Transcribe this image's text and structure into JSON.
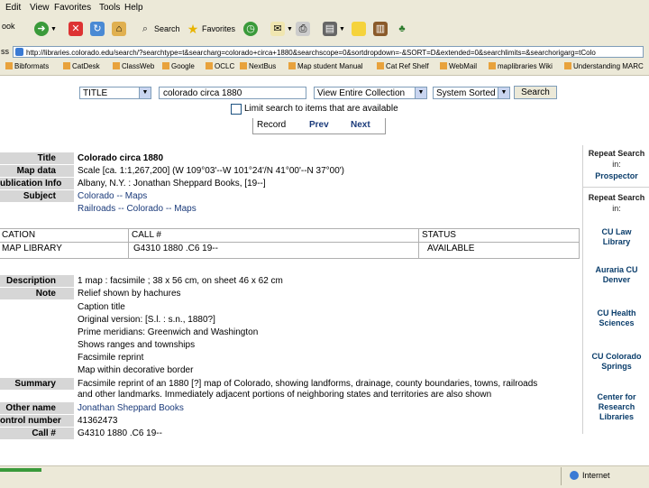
{
  "menu": [
    "Edit",
    "View",
    "Favorites",
    "Tools",
    "Help"
  ],
  "toolbar": {
    "back_label": "ook",
    "search_label": "Search",
    "favorites_label": "Favorites"
  },
  "address": {
    "label": "ss",
    "url": "http://libraries.colorado.edu/search/?searchtype=t&searcharg=colorado+circa+1880&searchscope=0&sortdropdown=-&SORT=D&extended=0&searchlimits=&searchorigarg=tColo"
  },
  "links": [
    "Bibformats",
    "CatDesk",
    "ClassWeb",
    "Google",
    "OCLC",
    "NextBus",
    "Map student Manual",
    "Cat Ref Shelf",
    "WebMail",
    "maplibraries Wiki",
    "Understanding MARC"
  ],
  "search": {
    "type": "TITLE",
    "query": "colorado circa 1880",
    "view": "View Entire Collection",
    "sort": "System Sorted",
    "button": "Search",
    "limit_label": "Limit search to items that are available"
  },
  "record_nav": {
    "record": "Record",
    "prev": "Prev",
    "next": "Next"
  },
  "record": [
    {
      "label": "Title",
      "value": "Colorado circa 1880",
      "bold": true
    },
    {
      "label": "Map data",
      "value": "Scale [ca. 1:1,267,200] (W 109°03'--W 101°24'/N 41°00'--N 37°00')"
    },
    {
      "label": "ublication Info",
      "value": "Albany, N.Y. : Jonathan Sheppard Books, [19--]"
    },
    {
      "label": "Subject",
      "value": "Colorado -- Maps"
    },
    {
      "label": "",
      "value": "Railroads -- Colorado -- Maps"
    }
  ],
  "holdings": {
    "headers": [
      "CATION",
      "CALL #",
      "STATUS"
    ],
    "row": [
      "MAP LIBRARY",
      "G4310 1880 .C6 19--",
      "AVAILABLE"
    ]
  },
  "notes": [
    {
      "label": "Description",
      "value": "1 map : facsimile ; 38 x 56 cm, on sheet 46 x 62 cm"
    },
    {
      "label": "Note",
      "value": "Relief shown by hachures"
    },
    {
      "label": "",
      "value": "Caption title"
    },
    {
      "label": "",
      "value": "Original version: [S.l. : s.n., 1880?]"
    },
    {
      "label": "",
      "value": "Prime meridians: Greenwich and Washington"
    },
    {
      "label": "",
      "value": "Shows ranges and townships"
    },
    {
      "label": "",
      "value": "Facsimile reprint"
    },
    {
      "label": "",
      "value": "Map within decorative border"
    }
  ],
  "summary": {
    "label": "Summary",
    "line1": "Facsimile reprint of an 1880 [?] map of Colorado, showing landforms, drainage, county boundaries, towns, railroads",
    "line2": "and other landmarks. Immediately adjacent portions of neighboring states and territories are also shown"
  },
  "extra": [
    {
      "label": "Other name",
      "value": "Jonathan Sheppard Books"
    },
    {
      "label": "ontrol number",
      "value": "41362473"
    },
    {
      "label": "Call #",
      "value": "G4310 1880 .C6 19--"
    }
  ],
  "sidebar": {
    "repeat1": "Repeat Search",
    "in1": "in:",
    "prospector": "Prospector",
    "repeat2": "Repeat Search",
    "in2": "in:",
    "items": [
      "CU Law Library",
      "Auraria CU Denver",
      "CU Health Sciences",
      "CU Colorado Springs",
      "Center for Research Libraries"
    ]
  },
  "status": {
    "zone": "Internet"
  }
}
